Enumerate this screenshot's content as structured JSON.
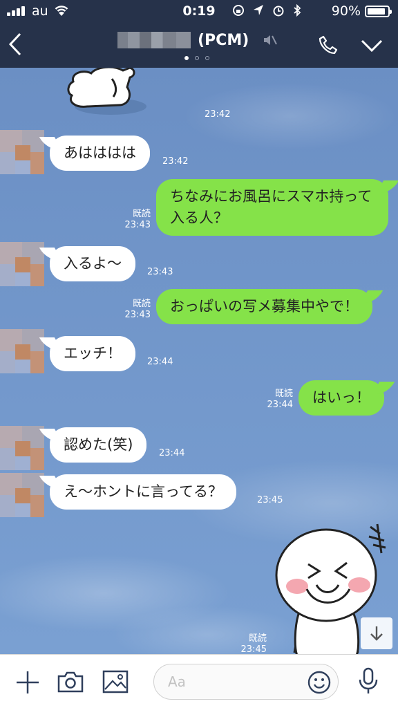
{
  "status": {
    "carrier": "au",
    "time": "0:19",
    "battery": "90%",
    "battery_level": 0.9
  },
  "header": {
    "title": "(PCM)",
    "pages": 3,
    "active_page": 0
  },
  "messages": [
    {
      "side": "in",
      "text": "あはははは",
      "time": "23:42"
    },
    {
      "side": "out",
      "text": "ちなみにお風呂にスマホ持って入る人？",
      "time": "23:43",
      "read": "既読"
    },
    {
      "side": "in",
      "text": "入るよ〜",
      "time": "23:43"
    },
    {
      "side": "out",
      "text": "おっぱいの写メ募集中やで！",
      "time": "23:43",
      "read": "既読"
    },
    {
      "side": "in",
      "text": "エッチ！",
      "time": "23:44"
    },
    {
      "side": "out",
      "text": "はいっ！",
      "time": "23:44",
      "read": "既読"
    },
    {
      "side": "in",
      "text": "認めた(笑)",
      "time": "23:44"
    },
    {
      "side": "in",
      "text": "え〜ホントに言ってる？",
      "time": "23:45"
    }
  ],
  "sticker_top_time": "23:42",
  "sticker_bottom": {
    "time": "23:45",
    "read": "既読"
  },
  "input": {
    "placeholder": "Aa"
  },
  "colors": {
    "header": "#26324a",
    "chat_bg": "#6f93c6",
    "outgoing": "#85e249",
    "incoming": "#ffffff"
  },
  "icons": [
    "back-icon",
    "mute-icon",
    "phone-icon",
    "chevron-down-icon",
    "scroll-down-icon",
    "plus-icon",
    "camera-icon",
    "image-icon",
    "emoji-icon",
    "mic-icon"
  ]
}
